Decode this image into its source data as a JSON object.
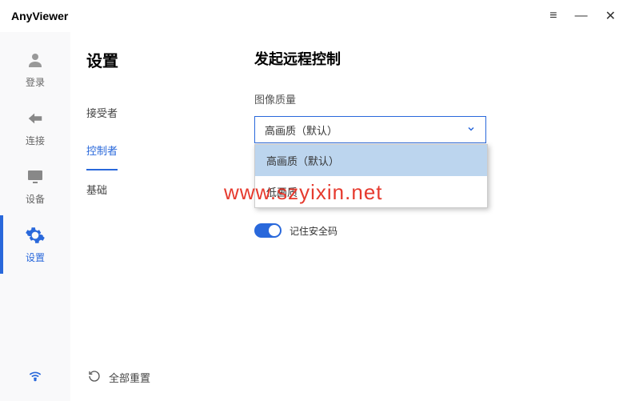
{
  "app": {
    "title": "AnyViewer"
  },
  "sidebar": {
    "items": [
      {
        "label": "登录"
      },
      {
        "label": "连接"
      },
      {
        "label": "设备"
      },
      {
        "label": "设置"
      }
    ]
  },
  "subSidebar": {
    "title": "设置",
    "items": [
      {
        "label": "接受者"
      },
      {
        "label": "控制者"
      },
      {
        "label": "基础"
      }
    ],
    "reset": "全部重置"
  },
  "content": {
    "title": "发起远程控制",
    "quality": {
      "label": "图像质量",
      "selected": "高画质（默认）",
      "options": [
        "高画质（默认）",
        "低画质"
      ]
    },
    "toggle": {
      "label": "记住安全码"
    }
  },
  "watermark": "www.szyixin.net"
}
